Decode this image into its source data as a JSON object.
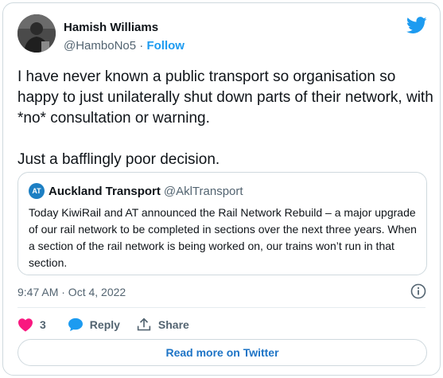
{
  "author": {
    "name": "Hamish Williams",
    "handle": "@HamboNo5",
    "separator": "·",
    "follow_label": "Follow"
  },
  "tweet": {
    "text": "I have never known a public transport so organisation so happy to just unilaterally shut down parts of their network, with *no* consultation or warning.\n\nJust a bafflingly poor decision."
  },
  "quoted": {
    "logo_text": "AT",
    "name": "Auckland Transport",
    "handle": "@AklTransport",
    "text": "Today KiwiRail and AT announced the Rail Network Rebuild – a major upgrade of our rail network to be completed in sections over the next three years. When a section of the rail network is being worked on, our trains won’t run in that section."
  },
  "timestamp": "9:47 AM · Oct 4, 2022",
  "actions": {
    "like_count": "3",
    "reply_label": "Reply",
    "share_label": "Share"
  },
  "read_more_label": "Read more on Twitter",
  "icons": {
    "brand": "twitter-bird-icon",
    "like": "heart-icon",
    "reply": "speech-bubble-icon",
    "share": "share-arrow-icon",
    "info": "info-icon"
  },
  "colors": {
    "twitter_blue": "#1d9bf0",
    "like_red": "#f91880",
    "read_more_blue": "#1d74c6",
    "secondary_text": "#536471",
    "border": "#cfd9de"
  }
}
